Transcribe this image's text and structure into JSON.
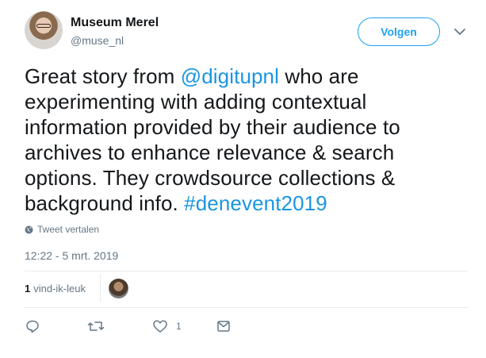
{
  "author": {
    "name": "Museum Merel",
    "handle": "@muse_nl"
  },
  "follow": {
    "label": "Volgen"
  },
  "tweet": {
    "text_1": "Great story from ",
    "mention": "@digitupnl",
    "text_2": " who are experimenting with adding contextual information provided by their audience to archives to enhance relevance & search options. They crowdsource collections & background info. ",
    "hashtag": "#denevent2019"
  },
  "translate": {
    "label": "Tweet vertalen"
  },
  "timestamp": "12:22 - 5 mrt. 2019",
  "likes": {
    "count": "1",
    "label": "vind-ik-leuk"
  },
  "actions": {
    "like_count": "1"
  },
  "colors": {
    "accent": "#1da1f2",
    "link": "#1b95e0",
    "muted": "#657786",
    "divider": "#e6ecf0"
  }
}
